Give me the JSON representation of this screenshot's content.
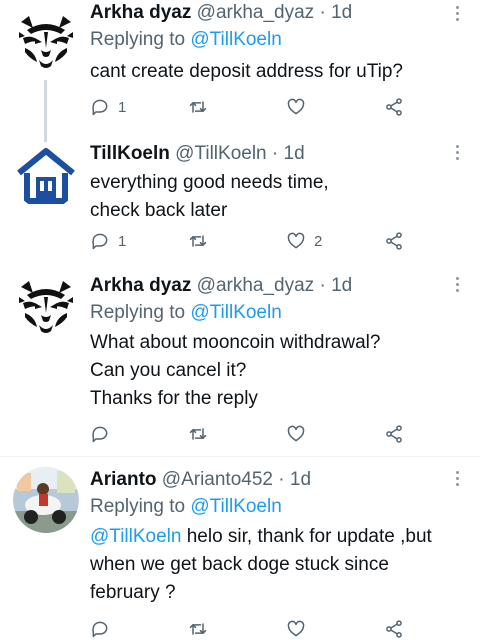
{
  "tweets": [
    {
      "name": "Arkha dyaz",
      "handle": "@arkha_dyaz",
      "time": "· 1d",
      "replying_label": "Replying to",
      "replying_to": "@TillKoeln",
      "lines": [
        "cant create deposit address for uTip?"
      ],
      "reply_count": "1",
      "retweet_count": "",
      "like_count": "",
      "avatar": "tiger-avatar"
    },
    {
      "name": "TillKoeln",
      "handle": "@TillKoeln",
      "time": "· 1d",
      "lines": [
        "everything good needs time,",
        "check back later"
      ],
      "reply_count": "1",
      "retweet_count": "",
      "like_count": "2",
      "avatar": "house-avatar"
    },
    {
      "name": "Arkha dyaz",
      "handle": "@arkha_dyaz",
      "time": "· 1d",
      "replying_label": "Replying to",
      "replying_to": "@TillKoeln",
      "lines": [
        "What about mooncoin withdrawal?",
        "Can you cancel it?",
        "Thanks for the reply"
      ],
      "reply_count": "",
      "retweet_count": "",
      "like_count": "",
      "avatar": "tiger-avatar"
    },
    {
      "name": "Arianto",
      "handle": "@Arianto452",
      "time": "· 1d",
      "replying_label": "Replying to",
      "replying_to": "@TillKoeln",
      "mention": "@TillKoeln",
      "lines": [
        " helo sir, thank for update ,but",
        "when we  get back doge stuck since",
        "february ?"
      ],
      "reply_count": "",
      "retweet_count": "",
      "like_count": "",
      "avatar": "photo-avatar"
    }
  ],
  "colors": {
    "link": "#1d9bf0",
    "muted": "#536471",
    "text": "#0f1419",
    "thread_line": "#cfd9de",
    "house_blue": "#1d4fa0"
  }
}
